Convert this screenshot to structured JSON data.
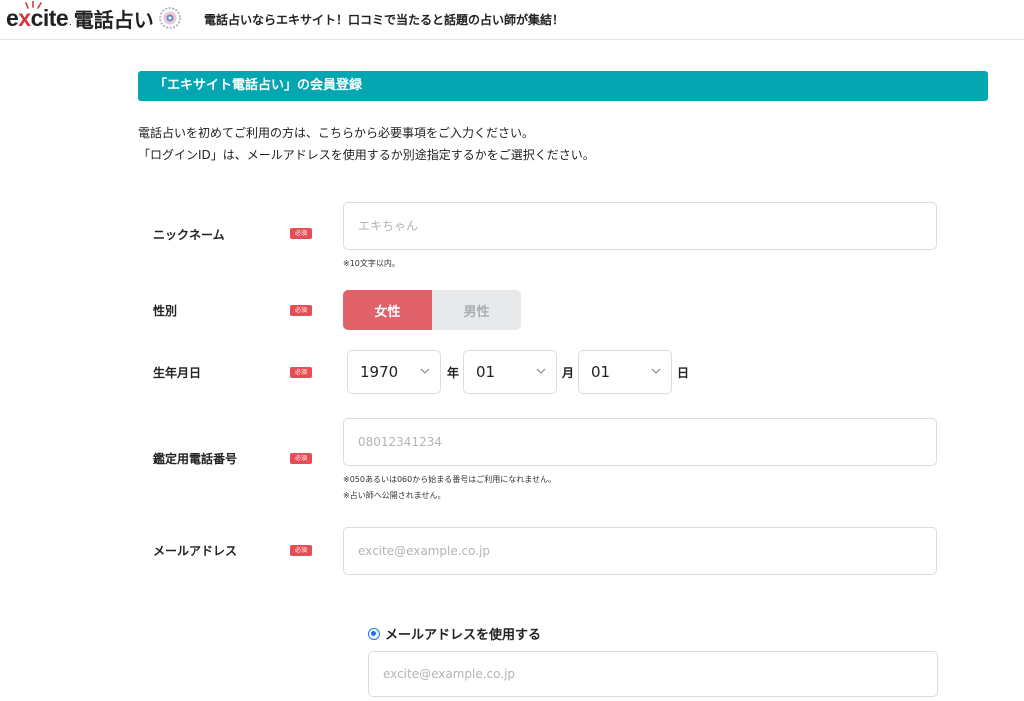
{
  "header": {
    "logo_brand_prefix": "e",
    "logo_brand_x": "x",
    "logo_brand_suffix": "cite",
    "logo_dot": ".",
    "logo_title": "電話占い",
    "tagline": "電話占いならエキサイト！口コミで当たると話題の占い師が集結！"
  },
  "section_title": "「エキサイト電話占い」の会員登録",
  "intro": {
    "line1": "電話占いを初めてご利用の方は、こちらから必要事項をご入力ください。",
    "line2": "「ログインID」は、メールアドレスを使用するか別途指定するかをご選択ください。"
  },
  "required_badge": "必須",
  "form": {
    "nickname": {
      "label": "ニックネーム",
      "placeholder": "エキちゃん",
      "note": "※10文字以内。"
    },
    "gender": {
      "label": "性別",
      "female": "女性",
      "male": "男性",
      "selected": "female"
    },
    "birthdate": {
      "label": "生年月日",
      "year": "1970",
      "year_unit": "年",
      "month": "01",
      "month_unit": "月",
      "day": "01",
      "day_unit": "日"
    },
    "phone": {
      "label": "鑑定用電話番号",
      "placeholder": "08012341234",
      "note1": "※050あるいは060から始まる番号はご利用になれません。",
      "note2": "※占い師へ公開されません。"
    },
    "email": {
      "label": "メールアドレス",
      "placeholder": "excite@example.co.jp"
    },
    "login_id": {
      "use_email_label": "メールアドレスを使用する",
      "placeholder": "excite@example.co.jp"
    }
  },
  "colors": {
    "accent_teal": "#04a6b2",
    "required_red": "#e64d55",
    "female_active": "#e0616a",
    "radio_blue": "#1a73e8"
  }
}
